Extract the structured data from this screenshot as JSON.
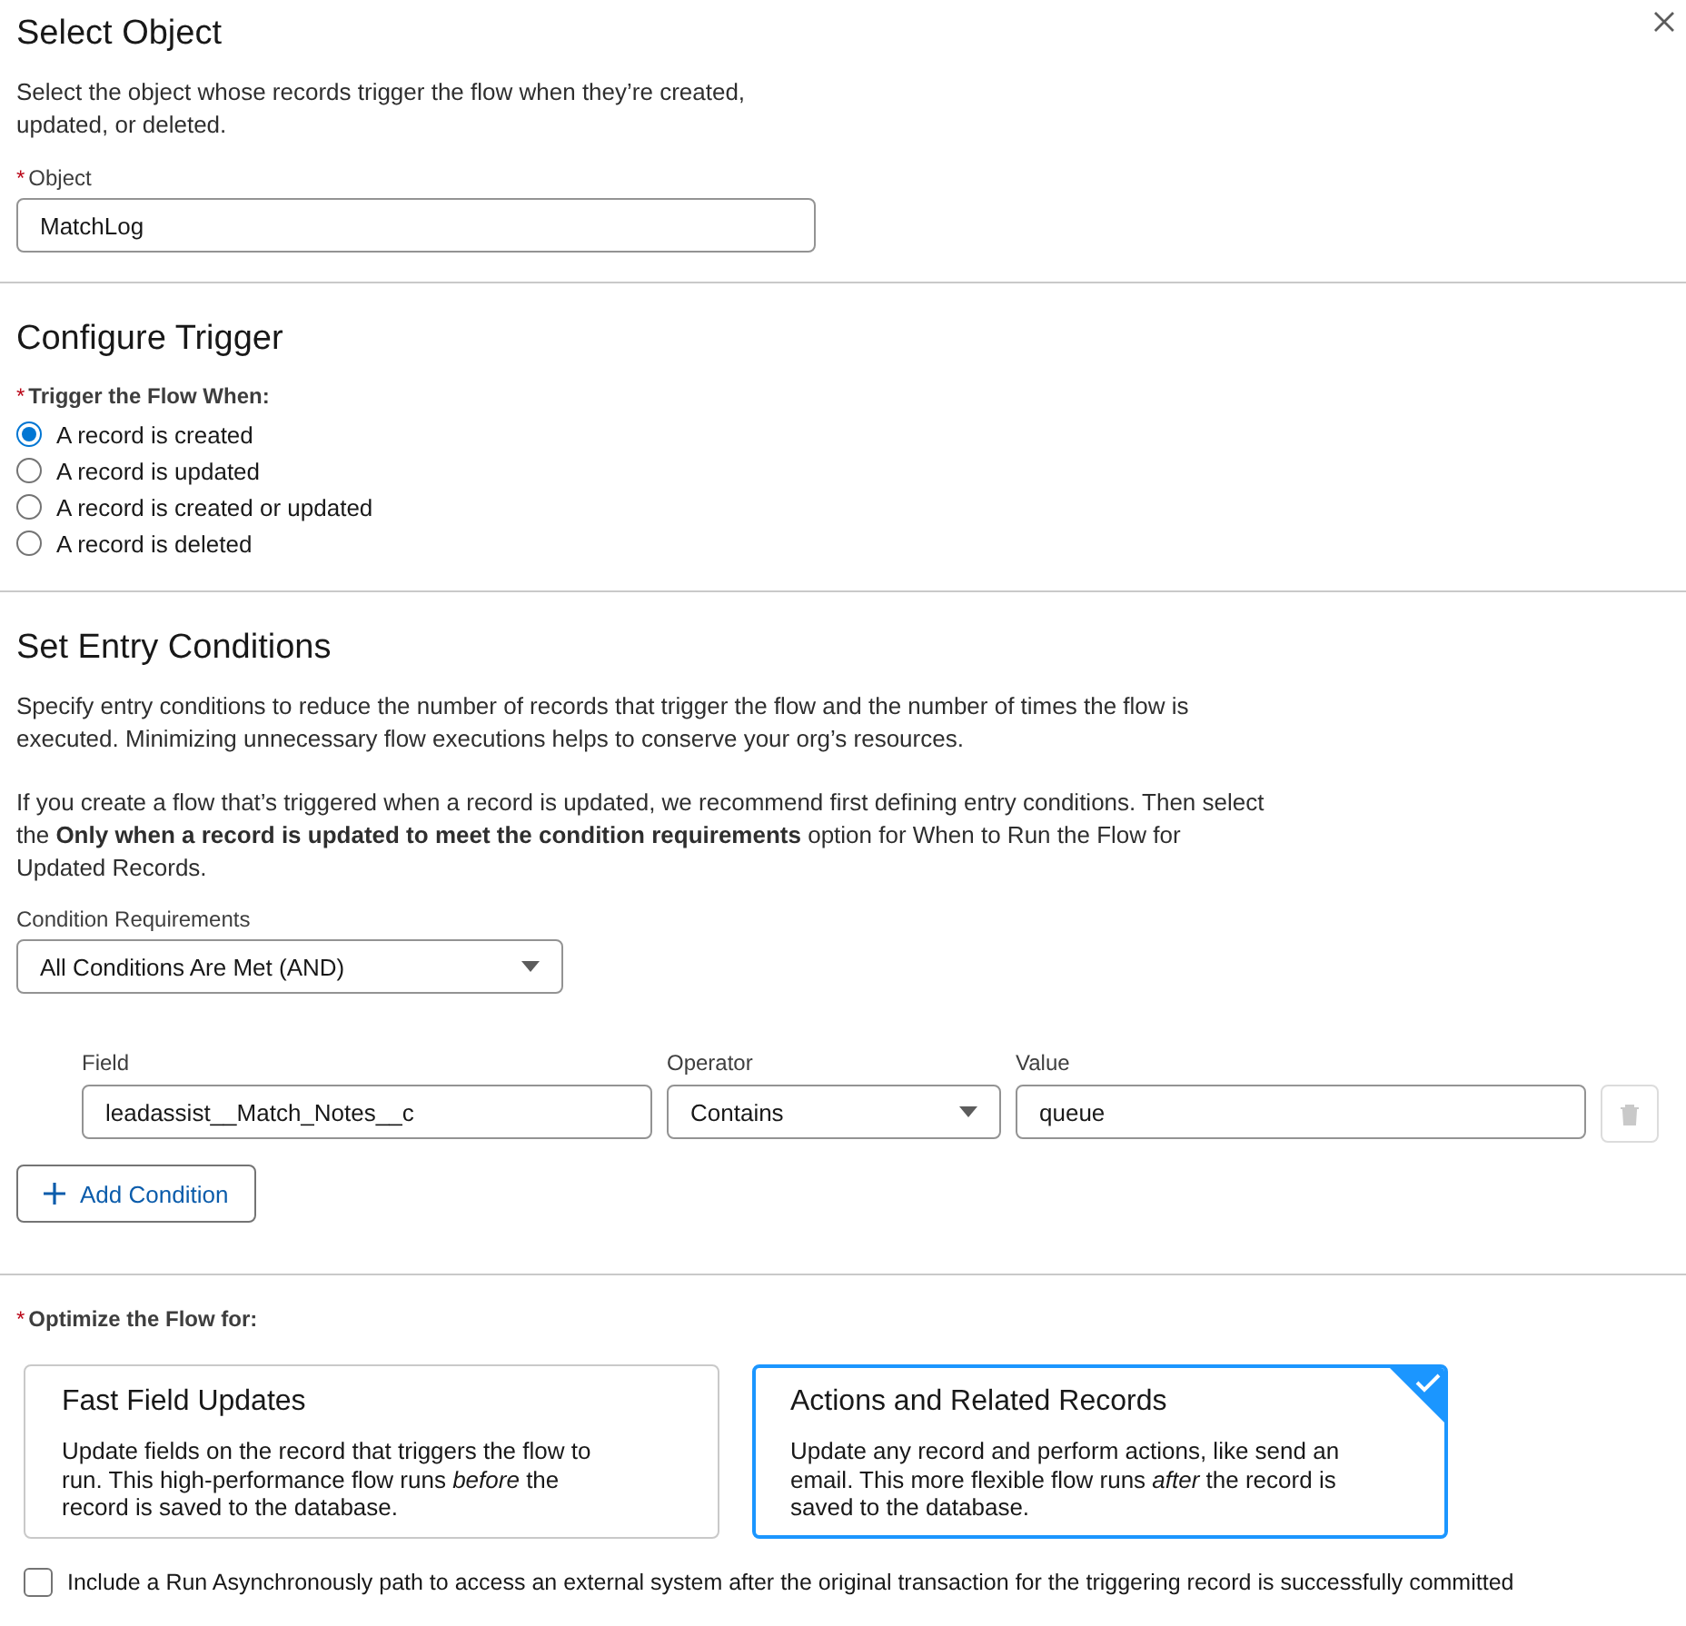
{
  "select_object": {
    "title": "Select Object",
    "description": "Select the object whose records trigger the flow when they’re created, updated, or deleted.",
    "object_field": {
      "required_mark": "*",
      "label": "Object",
      "value": "MatchLog"
    }
  },
  "configure_trigger": {
    "title": "Configure Trigger",
    "group_label": {
      "required_mark": "*",
      "label": "Trigger the Flow When:"
    },
    "options": [
      {
        "label": "A record is created",
        "selected": true
      },
      {
        "label": "A record is updated",
        "selected": false
      },
      {
        "label": "A record is created or updated",
        "selected": false
      },
      {
        "label": "A record is deleted",
        "selected": false
      }
    ]
  },
  "entry_conditions": {
    "title": "Set Entry Conditions",
    "paragraphs": [
      "Specify entry conditions to reduce the number of records that trigger the flow and the number of times the flow is executed. Minimizing unnecessary flow executions helps to conserve your org’s resources.",
      "If you create a flow that’s triggered when a record is updated, we recommend first defining entry conditions. Then select the **Only when a record is updated to meet the condition requirements** option for When to Run the Flow for Updated Records."
    ],
    "requirements": {
      "label": "Condition Requirements",
      "value": "All Conditions Are Met (AND)"
    },
    "columns": [
      "Field",
      "Operator",
      "Value"
    ],
    "conditions": [
      {
        "field": "leadassist__Match_Notes__c",
        "operator": "Contains",
        "value": "queue"
      }
    ],
    "add_button": "Add Condition"
  },
  "optimize": {
    "required_mark": "*",
    "label": "Optimize the Flow for:",
    "cards": [
      {
        "title": "Fast Field Updates",
        "description": "Update fields on the record that triggers the flow to run. This high-performance flow runs *before* the record is saved to the database.",
        "selected": false
      },
      {
        "title": "Actions and Related Records",
        "description": "Update any record and perform actions, like send an email. This more flexible flow runs *after* the record is saved to the database.",
        "selected": true
      }
    ]
  },
  "async_option": {
    "label": "Include a Run Asynchronously path to access an external system after the original transaction for the triggering record is successfully committed",
    "checked": false
  }
}
